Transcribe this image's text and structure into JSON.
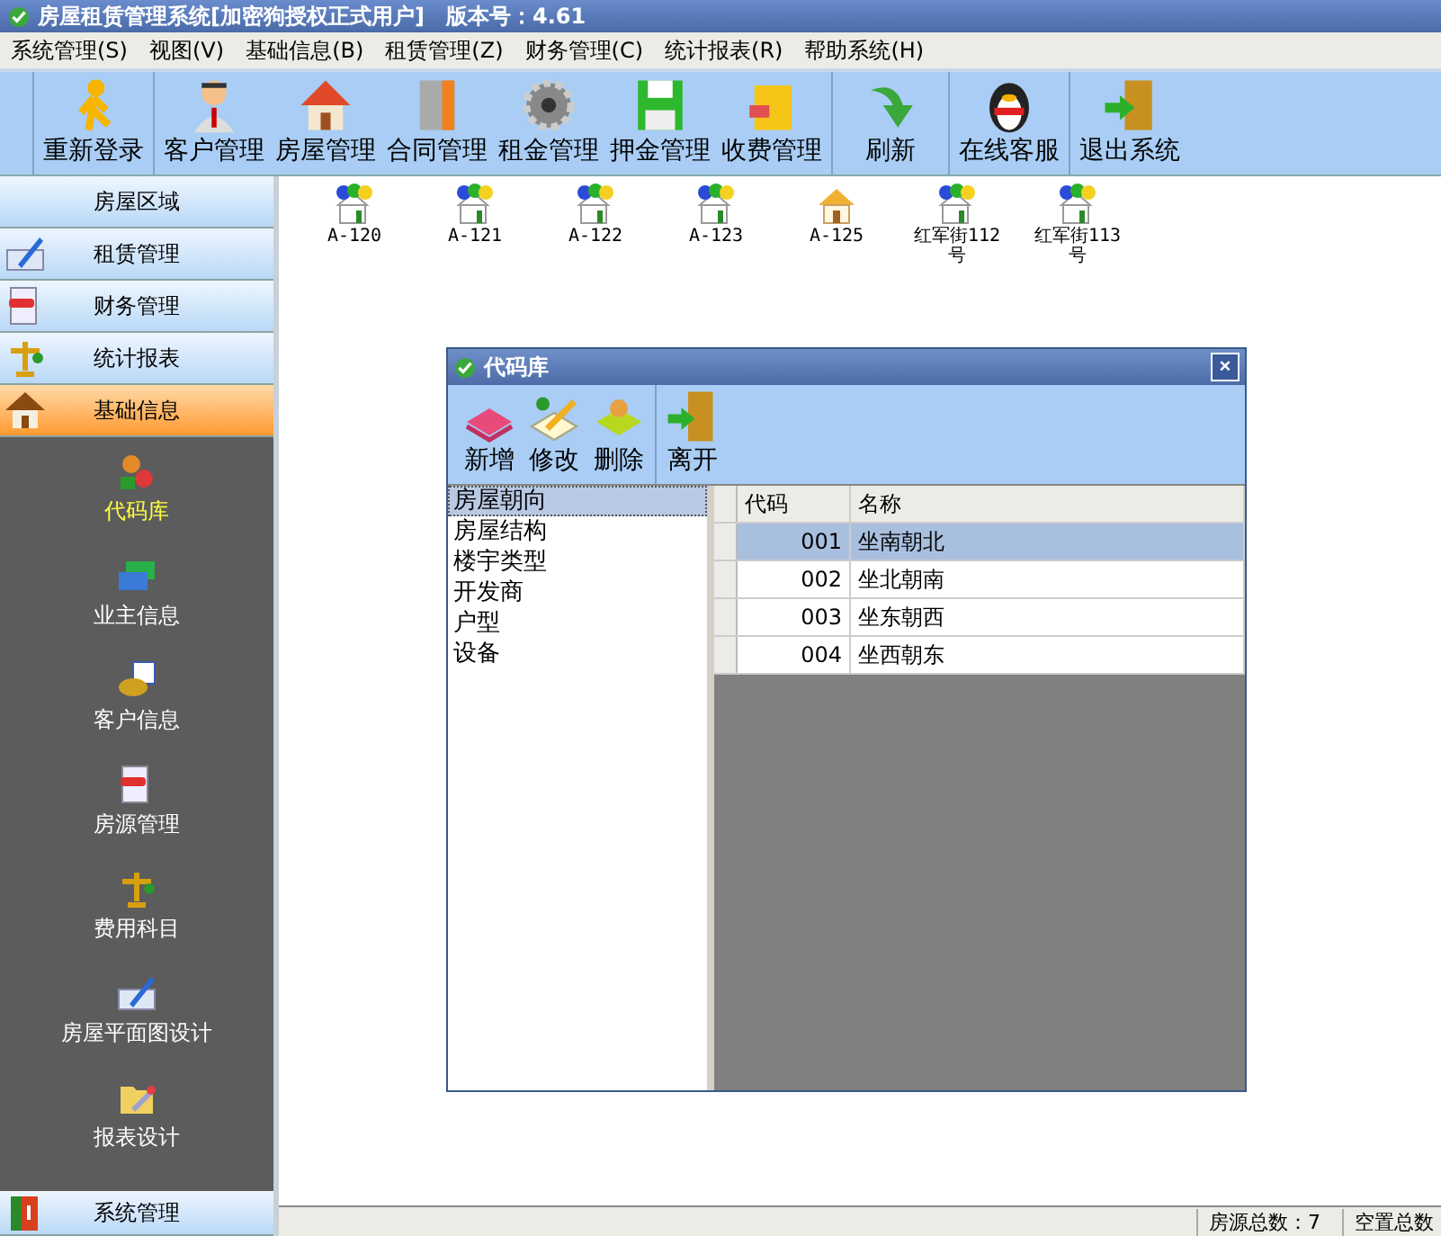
{
  "window": {
    "title": "房屋租赁管理系统[加密狗授权正式用户]　版本号：4.61"
  },
  "menu": [
    "系统管理(S)",
    "视图(V)",
    "基础信息(B)",
    "租赁管理(Z)",
    "财务管理(C)",
    "统计报表(R)",
    "帮助系统(H)"
  ],
  "toolbar": [
    [
      "重新登录"
    ],
    [
      "客户管理",
      "房屋管理",
      "合同管理",
      "租金管理",
      "押金管理",
      "收费管理"
    ],
    [
      "刷新"
    ],
    [
      "在线客服"
    ],
    [
      "退出系统"
    ]
  ],
  "sidebar": {
    "sections": [
      {
        "label": "房屋区域",
        "selected": false
      },
      {
        "label": "租赁管理",
        "selected": false
      },
      {
        "label": "财务管理",
        "selected": false
      },
      {
        "label": "统计报表",
        "selected": false
      },
      {
        "label": "基础信息",
        "selected": true
      }
    ],
    "items": [
      {
        "label": "代码库",
        "selected": true
      },
      {
        "label": "业主信息",
        "selected": false
      },
      {
        "label": "客户信息",
        "selected": false
      },
      {
        "label": "房源管理",
        "selected": false
      },
      {
        "label": "费用科目",
        "selected": false
      },
      {
        "label": "房屋平面图设计",
        "selected": false
      },
      {
        "label": "报表设计",
        "selected": false
      }
    ],
    "footer": "系统管理"
  },
  "houses": [
    {
      "label": "A-120",
      "kind": "occupied"
    },
    {
      "label": "A-121",
      "kind": "occupied"
    },
    {
      "label": "A-122",
      "kind": "occupied"
    },
    {
      "label": "A-123",
      "kind": "occupied"
    },
    {
      "label": "A-125",
      "kind": "vacant"
    },
    {
      "label": "红军街112号",
      "kind": "occupied"
    },
    {
      "label": "红军街113号",
      "kind": "occupied"
    }
  ],
  "dialog": {
    "title": "代码库",
    "close": "×",
    "toolbar": [
      [
        "新增",
        "修改",
        "删除"
      ],
      [
        "离开"
      ]
    ],
    "categories": [
      {
        "label": "房屋朝向",
        "selected": true
      },
      {
        "label": "房屋结构",
        "selected": false
      },
      {
        "label": "楼宇类型",
        "selected": false
      },
      {
        "label": "开发商",
        "selected": false
      },
      {
        "label": "户型",
        "selected": false
      },
      {
        "label": "设备",
        "selected": false
      }
    ],
    "table": {
      "columns": [
        "代码",
        "名称"
      ],
      "rows": [
        {
          "cells": [
            "001",
            "坐南朝北"
          ],
          "selected": true
        },
        {
          "cells": [
            "002",
            "坐北朝南"
          ],
          "selected": false
        },
        {
          "cells": [
            "003",
            "坐东朝西"
          ],
          "selected": false
        },
        {
          "cells": [
            "004",
            "坐西朝东"
          ],
          "selected": false
        }
      ]
    }
  },
  "status_bar": [
    "房源总数：7",
    "空置总数"
  ]
}
